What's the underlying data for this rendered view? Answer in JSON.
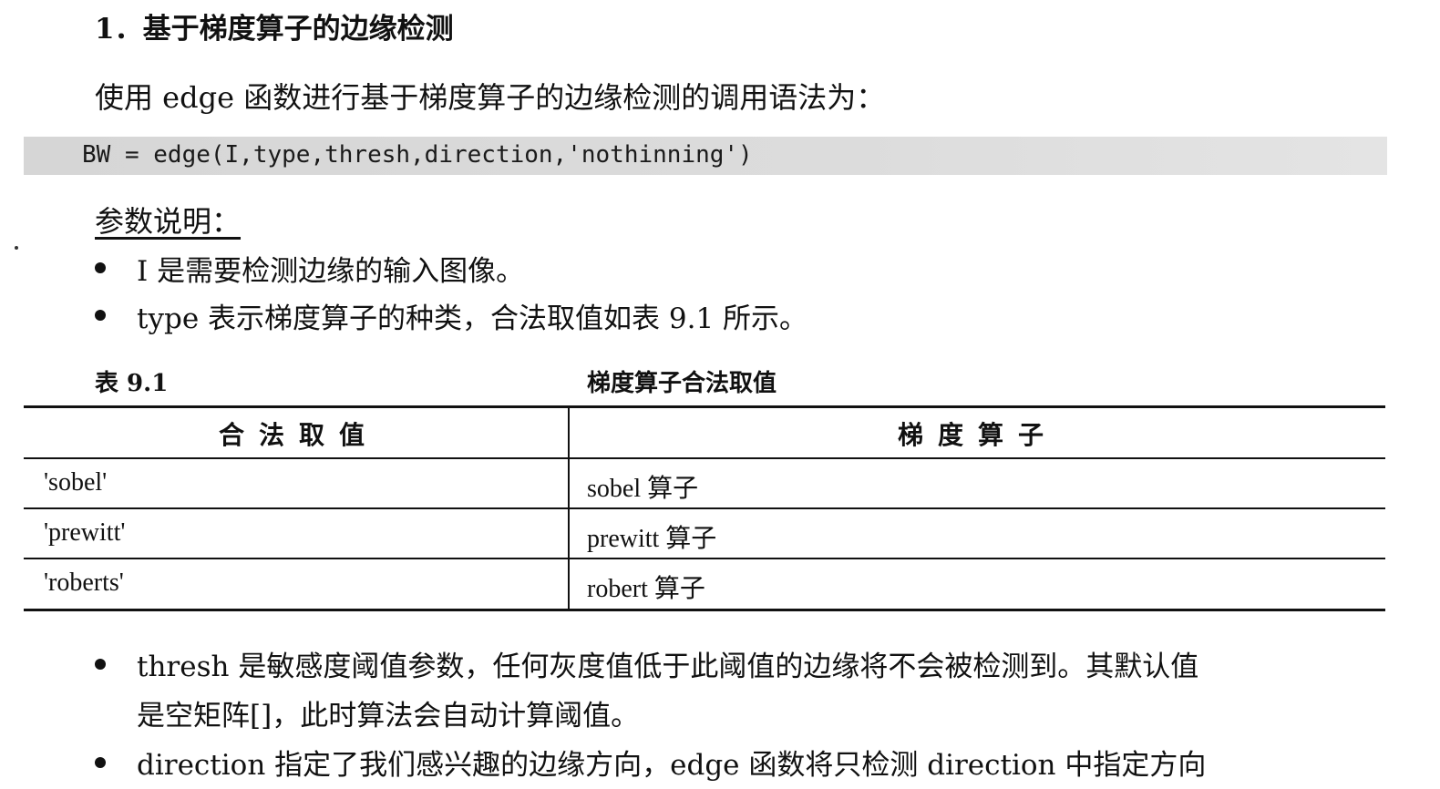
{
  "section_title": "1．基于梯度算子的边缘检测",
  "intro": "使用 edge 函数进行基于梯度算子的边缘检测的调用语法为：",
  "code": "BW = edge(I,type,thresh,direction,'nothinning')",
  "params_heading": "参数说明：",
  "bullets_top": [
    "I 是需要检测边缘的输入图像。",
    "type 表示梯度算子的种类，合法取值如表 9.1 所示。"
  ],
  "table": {
    "caption_number": "表 9.1",
    "caption_title": "梯度算子合法取值",
    "headers": [
      "合法取值",
      "梯度算子"
    ],
    "rows": [
      [
        "'sobel'",
        "sobel 算子"
      ],
      [
        "'prewitt'",
        "prewitt 算子"
      ],
      [
        "'roberts'",
        "robert 算子"
      ]
    ]
  },
  "bullets_bottom": [
    {
      "line1": "thresh 是敏感度阈值参数，任何灰度值低于此阈值的边缘将不会被检测到。其默认值",
      "line2": "是空矩阵[]，此时算法会自动计算阈值。"
    },
    {
      "line1": "direction 指定了我们感兴趣的边缘方向，edge 函数将只检测 direction 中指定方向"
    }
  ]
}
